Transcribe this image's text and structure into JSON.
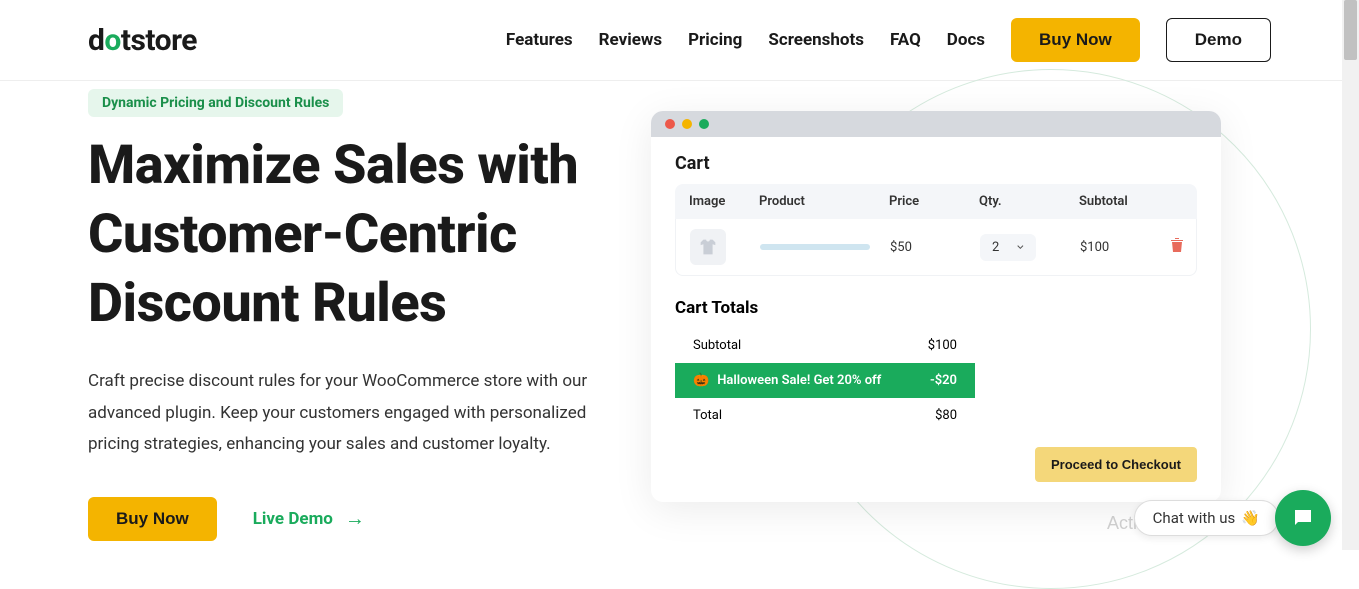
{
  "logo": {
    "part1": "d",
    "part2": "o",
    "part3": "tstore"
  },
  "nav": {
    "features": "Features",
    "reviews": "Reviews",
    "pricing": "Pricing",
    "screenshots": "Screenshots",
    "faq": "FAQ",
    "docs": "Docs",
    "buy": "Buy Now",
    "demo": "Demo"
  },
  "badge": "Dynamic Pricing and Discount Rules",
  "hero": {
    "title": "Maximize Sales with Customer-Centric Discount Rules",
    "text": "Craft precise discount rules for your WooCommerce store with our advanced plugin. Keep your customers engaged with personalized pricing strategies, enhancing your sales and customer loyalty.",
    "buy": "Buy Now",
    "live_demo": "Live Demo",
    "arrow": "→"
  },
  "mock": {
    "cart_title": "Cart",
    "headers": {
      "image": "Image",
      "product": "Product",
      "price": "Price",
      "qty": "Qty.",
      "subtotal": "Subtotal"
    },
    "row": {
      "price": "$50",
      "qty": "2",
      "subtotal": "$100"
    },
    "totals_title": "Cart Totals",
    "subtotal_label": "Subtotal",
    "subtotal_value": "$100",
    "sale_emoji": "🎃",
    "sale_text": "Halloween Sale! Get 20% off",
    "sale_value": "-$20",
    "total_label": "Total",
    "total_value": "$80",
    "checkout": "Proceed to Checkout"
  },
  "chat": "Chat with us",
  "chat_emoji": "👋",
  "watermark": "Activate Windows"
}
